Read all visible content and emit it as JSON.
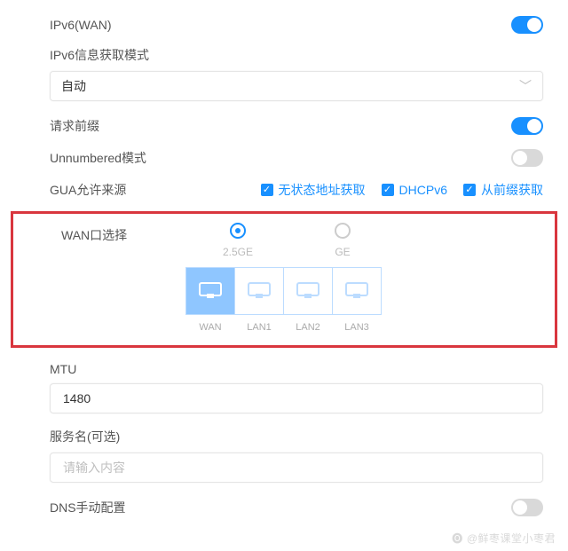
{
  "ipv6_wan": {
    "label": "IPv6(WAN)",
    "on": true
  },
  "ipv6_mode": {
    "label": "IPv6信息获取模式",
    "select_value": "自动"
  },
  "request_prefix": {
    "label": "请求前缀",
    "on": true
  },
  "unnumbered": {
    "label": "Unnumbered模式",
    "on": false
  },
  "gua": {
    "label": "GUA允许来源",
    "options": [
      {
        "label": "无状态地址获取",
        "checked": true
      },
      {
        "label": "DHCPv6",
        "checked": true
      },
      {
        "label": "从前缀获取",
        "checked": true
      }
    ]
  },
  "wan_select": {
    "label": "WAN口选择",
    "radios": [
      {
        "label": "2.5GE",
        "selected": true
      },
      {
        "label": "GE",
        "selected": false
      }
    ],
    "ports": [
      {
        "label": "WAN",
        "selected": true
      },
      {
        "label": "LAN1",
        "selected": false
      },
      {
        "label": "LAN2",
        "selected": false
      },
      {
        "label": "LAN3",
        "selected": false
      }
    ]
  },
  "mtu": {
    "label": "MTU",
    "value": "1480"
  },
  "service_name": {
    "label": "服务名(可选)",
    "placeholder": "请输入内容",
    "value": ""
  },
  "dns_manual": {
    "label": "DNS手动配置",
    "on": false
  },
  "watermark": "@鲜枣课堂小枣君"
}
